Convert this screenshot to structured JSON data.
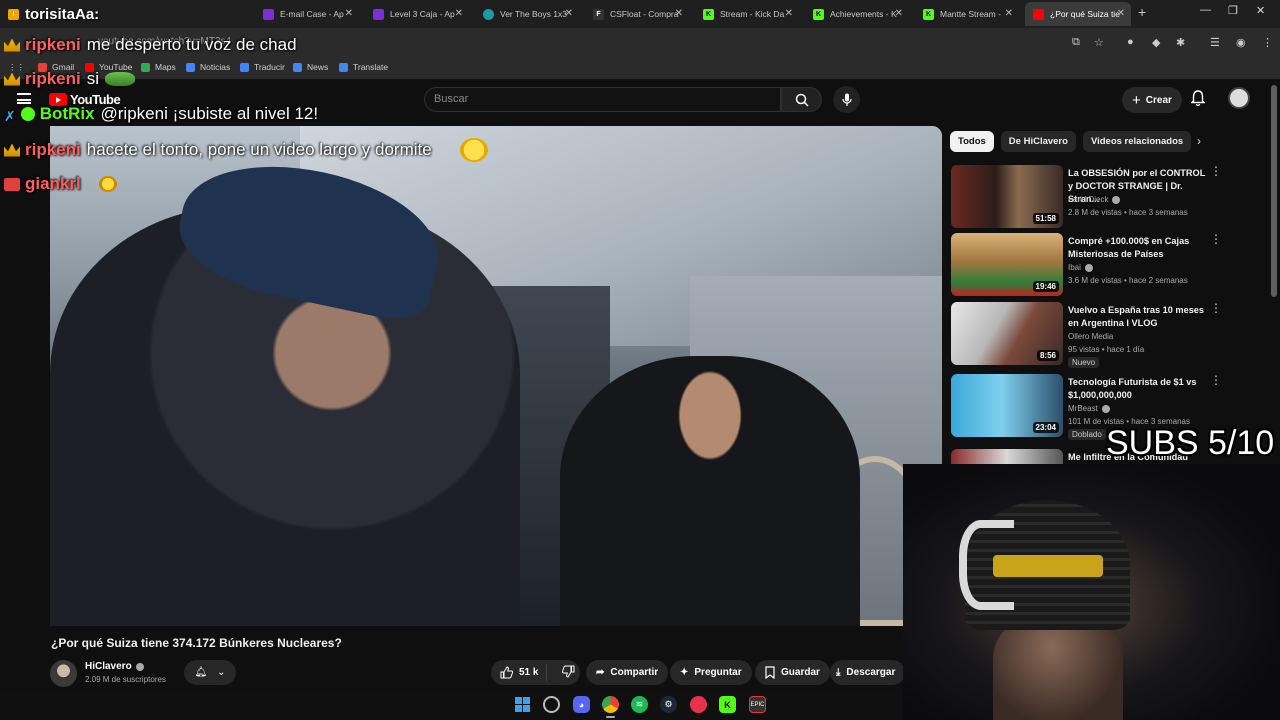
{
  "browser": {
    "tabs": [
      {
        "label": "torisitaAa:",
        "color": "#9146ff",
        "active": false
      },
      {
        "label": "E-mail Case - Ap",
        "color": "#7b2fd6",
        "active": false
      },
      {
        "label": "Level 3 Caja - Ap",
        "color": "#7b2fd6",
        "active": false
      },
      {
        "label": "Ver The Boys 1x3",
        "color": "#1b9aaa",
        "active": false
      },
      {
        "label": "CSFloat - Compra",
        "color": "#333333",
        "active": false
      },
      {
        "label": "Stream - Kick Da",
        "color": "#53fc18",
        "active": false
      },
      {
        "label": "Achievements - K",
        "color": "#53fc18",
        "active": false
      },
      {
        "label": "Mantte Stream - ",
        "color": "#53fc18",
        "active": false
      },
      {
        "label": "¿Por qué Suiza tie",
        "color": "#ff0000",
        "active": true
      }
    ],
    "url": "youtube.com/watch?v=MT3s4",
    "bookmarks": [
      {
        "label": "Gmail",
        "color": "#ea4335"
      },
      {
        "label": "YouTube",
        "color": "#ff0000"
      },
      {
        "label": "Maps",
        "color": "#34a853"
      },
      {
        "label": "Noticias",
        "color": "#4285f4"
      },
      {
        "label": "Traducir",
        "color": "#4285f4"
      },
      {
        "label": "News",
        "color": "#4285f4"
      },
      {
        "label": "Translate",
        "color": "#4285f4"
      }
    ]
  },
  "yt": {
    "logo_text": "YouTube",
    "search_placeholder": "Buscar",
    "create_label": "Crear"
  },
  "chat": [
    {
      "user": "ripkeni",
      "color": "#ff5f5f",
      "message": "me desperto tu voz de chad",
      "badge": "crown"
    },
    {
      "user": "ripkeni",
      "color": "#ff5f5f",
      "message": "si",
      "badge": "crown"
    },
    {
      "user": "BotRix",
      "color": "#53fc18",
      "message": "@ripkeni ¡subiste al nivel 12!",
      "badge": "bot"
    },
    {
      "user": "ripkeni",
      "color": "#ff5f5f",
      "message": "hacete el tonto, pone un video largo y dormite",
      "badge": "crown"
    },
    {
      "user": "giankrl",
      "color": "#ff5f5f",
      "message": "",
      "badge": "sub"
    }
  ],
  "video": {
    "title": "¿Por qué Suiza tiene 374.172 Búnkeres Nucleares?",
    "channel": "HiClavero",
    "subscribers": "2.09 M de suscriptores",
    "likes": "51 k",
    "actions": {
      "share": "Compartir",
      "ask": "Preguntar",
      "save": "Guardar",
      "download": "Descargar"
    }
  },
  "sidebar": {
    "chips": [
      "Todos",
      "De HiClavero",
      "Videos relacionados"
    ],
    "recommendations": [
      {
        "title": "La OBSESIÓN por el CONTROL y DOCTOR STRANGE | Dr. Stran...",
        "channel": "Farid Dieck",
        "meta": "2.8 M de vistas • hace 3 semanas",
        "duration": "51:58",
        "badge": ""
      },
      {
        "title": "Compré +100.000$ en Cajas Misteriosas de Países",
        "channel": "Ibai",
        "meta": "3.6 M de vistas • hace 2 semanas",
        "duration": "19:46",
        "badge": ""
      },
      {
        "title": "Vuelvo a España tras 10 meses en Argentina I VLOG",
        "channel": "Ollero Media",
        "meta": "95 vistas • hace 1 día",
        "duration": "8:56",
        "badge": "Nuevo"
      },
      {
        "title": "Tecnología Futurista de $1 vs $1,000,000,000",
        "channel": "MrBeast",
        "meta": "101 M de vistas • hace 3 semanas",
        "duration": "23:04",
        "badge": "Doblado"
      },
      {
        "title": "Me Infiltré en la Comunidad",
        "channel": "",
        "meta": "",
        "duration": "",
        "badge": ""
      }
    ]
  },
  "overlay": {
    "subs_goal": "SUBS 5/10"
  }
}
